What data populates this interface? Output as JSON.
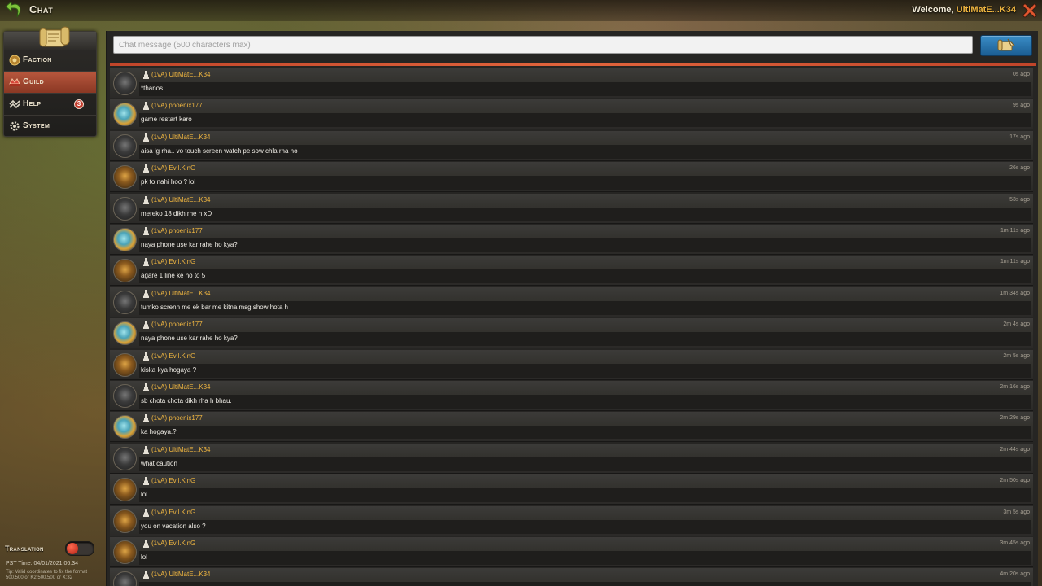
{
  "header": {
    "title": "Chat",
    "welcome_prefix": "Welcome, ",
    "username": "UltiMatE...K34",
    "close_label": "close"
  },
  "sidebar": {
    "items": [
      {
        "label": "Faction",
        "icon": "faction-icon",
        "active": false
      },
      {
        "label": "Guild",
        "icon": "guild-icon",
        "active": true
      },
      {
        "label": "Help",
        "icon": "help-icon",
        "active": false,
        "badge": "3"
      },
      {
        "label": "System",
        "icon": "gear-icon",
        "active": false
      }
    ]
  },
  "footer": {
    "translation_label": "Translation",
    "translation_enabled": true,
    "pst_time": "PST Time: 04/01/2021 06:34",
    "tip": "Tip: Valid coordinates to fix the format 500,500 or K2:500,500 or X:32"
  },
  "chat_input": {
    "placeholder": "Chat message (500 characters max)",
    "value": ""
  },
  "colors": {
    "accent": "#c1452a",
    "username": "#f0b640",
    "send_button": "#2a77b0"
  },
  "messages": [
    {
      "avatar": "ulti",
      "name": "(1vA) UltiMatE...K34",
      "text": "*thanos",
      "time": "0s ago"
    },
    {
      "avatar": "phoenix",
      "name": "(1vA) phoenix177",
      "text": "game restart karo",
      "time": "9s ago"
    },
    {
      "avatar": "ulti",
      "name": "(1vA) UltiMatE...K34",
      "text": "aisa lg rha.. vo touch screen watch pe sow chla rha ho",
      "time": "17s ago"
    },
    {
      "avatar": "evil",
      "name": "(1vA) Evil.KinG",
      "text": "pk to nahi hoo ? lol",
      "time": "26s ago"
    },
    {
      "avatar": "ulti",
      "name": "(1vA) UltiMatE...K34",
      "text": "mereko 18 dikh rhe h xD",
      "time": "53s ago"
    },
    {
      "avatar": "phoenix",
      "name": "(1vA) phoenix177",
      "text": "naya phone use kar rahe ho kya?",
      "time": "1m 11s ago"
    },
    {
      "avatar": "evil",
      "name": "(1vA) Evil.KinG",
      "text": "agare 1 line ke ho to 5",
      "time": "1m 11s ago"
    },
    {
      "avatar": "ulti",
      "name": "(1vA) UltiMatE...K34",
      "text": "tumko screnn me ek bar me kitna msg show hota h",
      "time": "1m 34s ago"
    },
    {
      "avatar": "phoenix",
      "name": "(1vA) phoenix177",
      "text": "naya phone use kar rahe ho kya?",
      "time": "2m 4s ago"
    },
    {
      "avatar": "evil",
      "name": "(1vA) Evil.KinG",
      "text": "kiska kya hogaya ?",
      "time": "2m 5s ago"
    },
    {
      "avatar": "ulti",
      "name": "(1vA) UltiMatE...K34",
      "text": "sb chota chota dikh rha h bhau.",
      "time": "2m 16s ago"
    },
    {
      "avatar": "phoenix",
      "name": "(1vA) phoenix177",
      "text": "ka hogaya.?",
      "time": "2m 29s ago"
    },
    {
      "avatar": "ulti",
      "name": "(1vA) UltiMatE...K34",
      "text": "what caution",
      "time": "2m 44s ago"
    },
    {
      "avatar": "evil",
      "name": "(1vA) Evil.KinG",
      "text": "lol",
      "time": "2m 50s ago"
    },
    {
      "avatar": "evil",
      "name": "(1vA) Evil.KinG",
      "text": "you on vacation also ?",
      "time": "3m 5s ago"
    },
    {
      "avatar": "evil",
      "name": "(1vA) Evil.KinG",
      "text": "lol",
      "time": "3m 45s ago"
    },
    {
      "avatar": "ulti",
      "name": "(1vA) UltiMatE...K34",
      "text": "",
      "time": "4m 20s ago"
    }
  ]
}
